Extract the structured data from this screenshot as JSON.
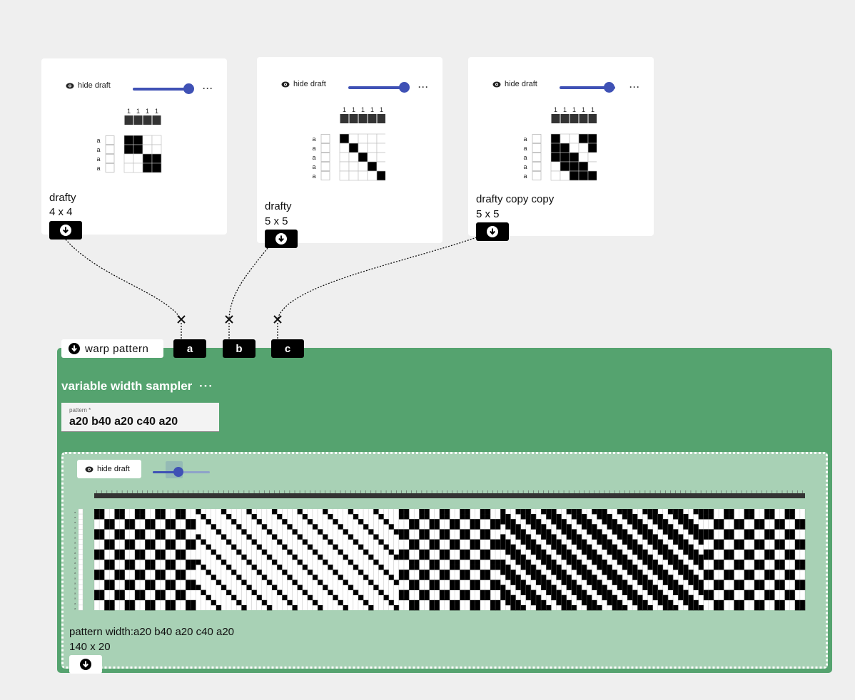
{
  "drafts": [
    {
      "hide_label": "hide draft",
      "menu": "···",
      "name": "drafty",
      "size": "4 x 4",
      "header_labels": [
        "1",
        "1",
        "1",
        "1"
      ],
      "row_labels": [
        "a",
        "a",
        "a",
        "a"
      ],
      "cells": [
        [
          1,
          1,
          0,
          0
        ],
        [
          1,
          1,
          0,
          0
        ],
        [
          0,
          0,
          1,
          1
        ],
        [
          0,
          0,
          1,
          1
        ]
      ]
    },
    {
      "hide_label": "hide draft",
      "menu": "···",
      "name": "drafty",
      "size": "5 x 5",
      "header_labels": [
        "1",
        "1",
        "1",
        "1",
        "1"
      ],
      "row_labels": [
        "a",
        "a",
        "a",
        "a",
        "a"
      ],
      "cells": [
        [
          1,
          0,
          0,
          0,
          0
        ],
        [
          0,
          1,
          0,
          0,
          0
        ],
        [
          0,
          0,
          1,
          0,
          0
        ],
        [
          0,
          0,
          0,
          1,
          0
        ],
        [
          0,
          0,
          0,
          0,
          1
        ]
      ]
    },
    {
      "hide_label": "hide draft",
      "menu": "···",
      "name": "drafty copy copy",
      "size": "5 x 5",
      "header_labels": [
        "1",
        "1",
        "1",
        "1",
        "1"
      ],
      "row_labels": [
        "a",
        "a",
        "a",
        "a",
        "a"
      ],
      "cells": [
        [
          1,
          0,
          0,
          1,
          1
        ],
        [
          1,
          1,
          0,
          0,
          1
        ],
        [
          1,
          1,
          1,
          0,
          0
        ],
        [
          0,
          1,
          1,
          1,
          0
        ],
        [
          0,
          0,
          1,
          1,
          1
        ]
      ]
    }
  ],
  "operation": {
    "port_label": "warp pattern",
    "inputs": [
      "a",
      "b",
      "c"
    ],
    "title": "variable width sampler",
    "menu": "···",
    "param_label": "pattern",
    "param_required_mark": "*",
    "param_value": "a20 b40 a20 c40 a20",
    "preview_hide_label": "hide draft",
    "output_name": "pattern width:a20 b40 a20 c40 a20",
    "output_size": "140 x 20"
  },
  "colors": {
    "accent": "#3f51b5",
    "operation_green": "#55a36f",
    "preview_green": "#a8d1b5"
  }
}
